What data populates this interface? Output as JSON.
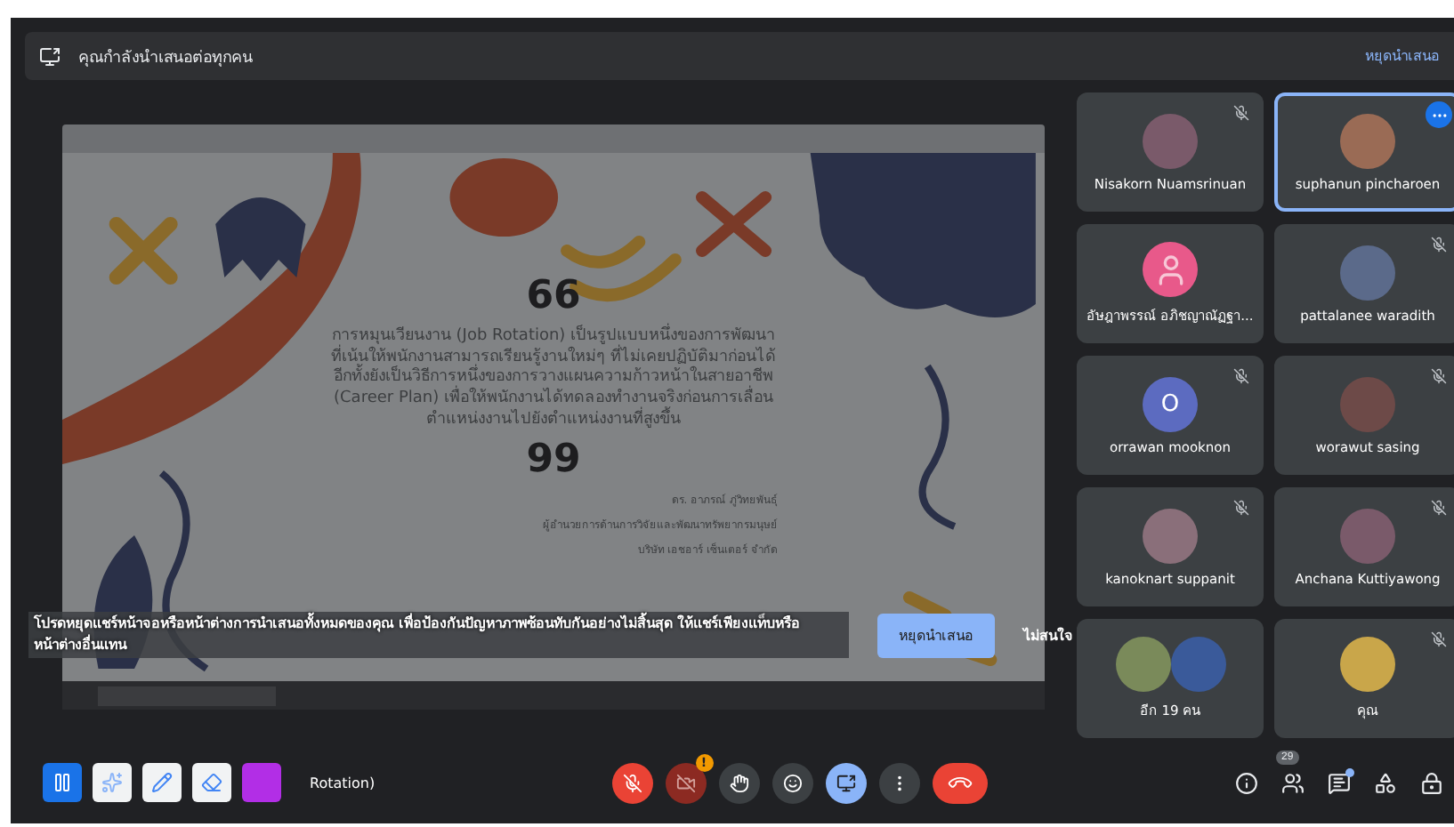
{
  "presenting_bar": {
    "message": "คุณกำลังนำเสนอต่อทุกคน",
    "action": "หยุดนำเสนอ"
  },
  "shared_screen": {
    "quote_open": "66",
    "quote_lines": [
      "การหมุนเวียนงาน (Job Rotation) เป็นรูปแบบหนึ่งของการพัฒนา",
      "ที่เน้นให้พนักงานสามารถเรียนรู้งานใหม่ๆ ที่ไม่เคยปฏิบัติมาก่อนได้",
      "อีกทั้งยังเป็นวิธีการหนึ่งของการวางแผนความก้าวหน้าในสายอาชีพ",
      "(Career Plan) เพื่อให้พนักงานได้ทดลองทำงานจริงก่อนการเลื่อน",
      "ตำแหน่งงานไปยังตำแหน่งงานที่สูงขึ้น"
    ],
    "quote_close": "99",
    "attribution": [
      "ดร. อาภรณ์ ภู่วิทยพันธุ์",
      "ผู้อำนวยการด้านการวิจัยและพัฒนาทรัพยากรมนุษย์",
      "บริษัท เอชอาร์ เซ็นเตอร์ จำกัด"
    ]
  },
  "warning": {
    "message": "โปรดหยุดแชร์หน้าจอหรือหน้าต่างการนำเสนอทั้งหมดของคุณ เพื่อป้องกันปัญหาภาพซ้อนทับกันอย่างไม่สิ้นสุด ให้แชร์เพียงแท็บหรือหน้าต่างอื่นแทน",
    "buttons": [
      {
        "label": "หยุดนำเสนอ",
        "kind": "primary"
      },
      {
        "label": "ไม่สนใจ",
        "kind": "text"
      }
    ]
  },
  "participants": [
    {
      "name": "Nisakorn Nuamsrinuan",
      "kind": "photo",
      "muted": true,
      "selected": false
    },
    {
      "name": "suphanun pincharoen",
      "kind": "photo",
      "muted": false,
      "selected": true
    },
    {
      "name": "อัษฎาพรรณ์ อภิชญาณัฏฐา...",
      "kind": "silhouette",
      "muted": false,
      "selected": false
    },
    {
      "name": "pattalanee waradith",
      "kind": "photo",
      "muted": true,
      "selected": false
    },
    {
      "name": "orrawan mooknon",
      "kind": "letter",
      "letter": "O",
      "muted": true,
      "selected": false
    },
    {
      "name": "worawut sasing",
      "kind": "photo",
      "muted": true,
      "selected": false
    },
    {
      "name": "kanoknart suppanit",
      "kind": "photo",
      "muted": true,
      "selected": false
    },
    {
      "name": "Anchana Kuttiyawong",
      "kind": "photo",
      "muted": true,
      "selected": false
    },
    {
      "name": "อีก 19 คน",
      "kind": "group",
      "muted": false,
      "selected": false
    },
    {
      "name": "คุณ",
      "kind": "photo",
      "muted": true,
      "selected": false
    }
  ],
  "annotation": {
    "behind_text": "Rotation)",
    "tools": [
      {
        "kind": "pause"
      },
      {
        "kind": "laser"
      },
      {
        "kind": "pen"
      },
      {
        "kind": "eraser"
      },
      {
        "kind": "color",
        "color": "#b22ee6"
      }
    ]
  },
  "controls": [
    {
      "kind": "mic",
      "on": false
    },
    {
      "kind": "camera",
      "on": false,
      "alert": "!"
    },
    {
      "kind": "hand",
      "on": false
    },
    {
      "kind": "emoji",
      "on": false
    },
    {
      "kind": "present",
      "on": true
    },
    {
      "kind": "more",
      "on": false
    },
    {
      "kind": "hangup"
    }
  ],
  "side_controls": [
    {
      "kind": "info"
    },
    {
      "kind": "people",
      "count": "29"
    },
    {
      "kind": "chat",
      "unread": true
    },
    {
      "kind": "activities"
    },
    {
      "kind": "lock"
    }
  ]
}
